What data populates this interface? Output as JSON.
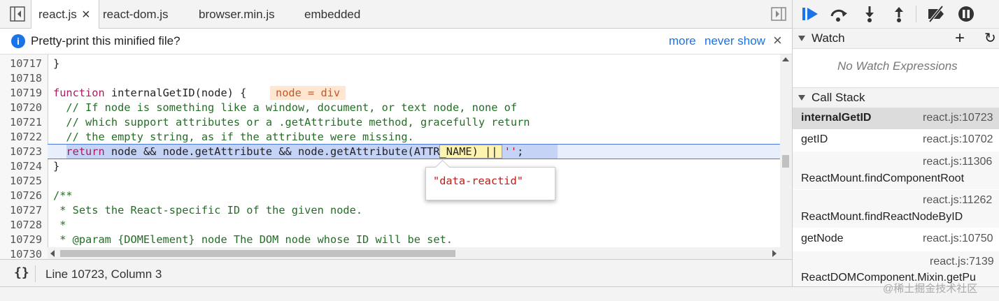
{
  "tabs": [
    {
      "label": "react.js",
      "active": true
    },
    {
      "label": "react-dom.js"
    },
    {
      "label": "browser.min.js"
    },
    {
      "label": "embedded"
    }
  ],
  "tab_close": "×",
  "infobar": {
    "message": "Pretty-print this minified file?",
    "more": "more",
    "never_show": "never show",
    "close": "×"
  },
  "code": {
    "line_numbers": [
      "10717",
      "10718",
      "10719",
      "10720",
      "10721",
      "10722",
      "10723",
      "10724",
      "10725",
      "10726",
      "10727",
      "10728",
      "10729",
      "10730"
    ],
    "lines": [
      "}",
      "",
      "function internalGetID(node) {",
      "  // If node is something like a window, document, or text node, none of",
      "  // which support attributes or a .getAttribute method, gracefully return",
      "  // the empty string, as if the attribute were missing.",
      "  return node && node.getAttribute && node.getAttribute(ATTR_NAME) || '';",
      "}",
      "",
      "/**",
      " * Sets the React-specific ID of the given node.",
      " *",
      " * @param {DOMElement} node The DOM node whose ID will be set.",
      ""
    ],
    "inline_value": "node = div",
    "tooltip": "\"data-reactid\""
  },
  "status": {
    "format_icon": "{}",
    "position": "Line 10723, Column 3"
  },
  "watch": {
    "title": "Watch",
    "add": "+",
    "refresh": "↻",
    "empty": "No Watch Expressions"
  },
  "callstack": {
    "title": "Call Stack",
    "frames": [
      {
        "name": "internalGetID",
        "loc": "react.js:10723",
        "selected": true
      },
      {
        "name": "getID",
        "loc": "react.js:10702"
      },
      {
        "name": "ReactMount.findComponentRoot",
        "loc": "react.js:11306"
      },
      {
        "name": "ReactMount.findReactNodeByID",
        "loc": "react.js:11262"
      },
      {
        "name": "getNode",
        "loc": "react.js:10750"
      },
      {
        "name": "ReactDOMComponent.Mixin.getPu",
        "loc": "react.js:7139"
      }
    ]
  },
  "watermark": "@稀土掘金技术社区",
  "colors": {
    "accent": "#1a73e8",
    "highlight_line": "#c5d3f6",
    "inline_value_bg": "#ffe6d1"
  }
}
